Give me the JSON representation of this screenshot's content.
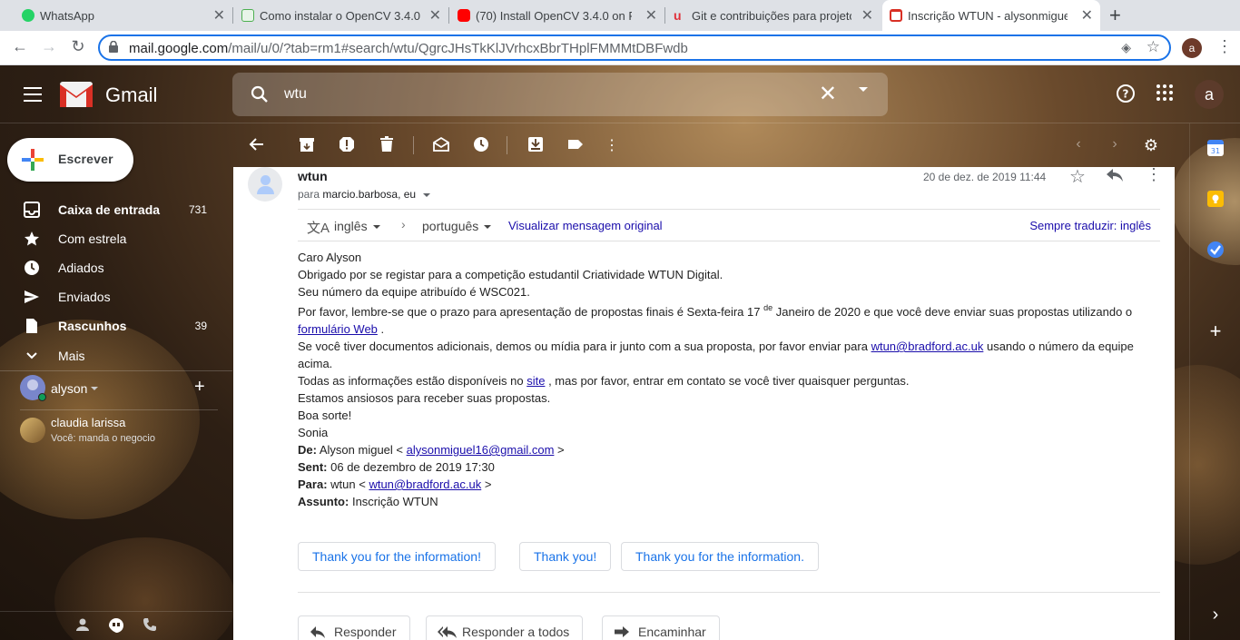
{
  "browser": {
    "tabs": [
      {
        "title": "WhatsApp",
        "icon": "whatsapp-icon",
        "color": "#25d366"
      },
      {
        "title": "Como instalar o OpenCV 3.4.0 c",
        "icon": "site-icon",
        "color": "#4caf50"
      },
      {
        "title": "(70) Install OpenCV 3.4.0 on Ras",
        "icon": "youtube-icon",
        "color": "#ff0000"
      },
      {
        "title": "Git e contribuições para projeto",
        "icon": "udemy-icon",
        "color": "#e0303a"
      },
      {
        "title": "Inscrição WTUN - alysonmiguel",
        "icon": "gmail-icon",
        "color": "#d93025"
      }
    ],
    "url_host": "mail.google.com",
    "url_path": "/mail/u/0/?tab=rm1#search/wtu/QgrcJHsTkKlJVrhcxBbrTHplFMMMtDBFwdb",
    "profile_initial": "a"
  },
  "gmail": {
    "brand": "Gmail",
    "search_value": "wtu",
    "account_initial": "a",
    "compose_label": "Escrever",
    "nav": [
      {
        "label": "Caixa de entrada",
        "count": "731",
        "icon": "inbox-icon",
        "bold": true
      },
      {
        "label": "Com estrela",
        "count": "",
        "icon": "star-icon",
        "bold": false
      },
      {
        "label": "Adiados",
        "count": "",
        "icon": "clock-icon",
        "bold": false
      },
      {
        "label": "Enviados",
        "count": "",
        "icon": "send-icon",
        "bold": false
      },
      {
        "label": "Rascunhos",
        "count": "39",
        "icon": "draft-icon",
        "bold": true
      },
      {
        "label": "Mais",
        "count": "",
        "icon": "chevron-down-icon",
        "bold": false
      }
    ],
    "hangouts": {
      "me": "alyson",
      "contact_name": "claudia larissa",
      "contact_status": "Você: manda o negocio"
    }
  },
  "message": {
    "sender": "wtun",
    "recipients_prefix": "para",
    "recipients": "marcio.barbosa, eu",
    "date": "20 de dez. de 2019 11:44",
    "translate": {
      "from": "inglês",
      "to": "português",
      "view_original": "Visualizar mensagem original",
      "always": "Sempre traduzir: inglês"
    },
    "body": {
      "greeting": "Caro Alyson",
      "line1": "Obrigado por se registar para a competição estudantil Criatividade WTUN Digital.",
      "line2": "Seu número da equipe atribuído é WSC021.",
      "line3_a": "Por favor, lembre-se que o prazo para apresentação de propostas finais é Sexta-feira 17",
      "line3_sup": "de",
      "line3_b": "Janeiro de 2020 e que você deve enviar suas propostas utilizando o",
      "line3_link": "formulário Web",
      "line3_end": ".",
      "line4_a": "Se você tiver documentos adicionais, demos ou mídia para ir junto com a sua proposta, por favor enviar para",
      "line4_link": "wtun@bradford.ac.uk",
      "line4_b": "usando o número da equipe",
      "line4_c": "acima.",
      "line5_a": "Todas as informações estão disponíveis no",
      "line5_link": "site",
      "line5_b": ", mas por favor, entrar em contato se você tiver quaisquer perguntas.",
      "line6": "Estamos ansiosos para receber suas propostas.",
      "line7": "Boa sorte!",
      "signature": "Sonia",
      "de_label": "De:",
      "de_name": "Alyson miguel <",
      "de_email": "alysonmiguel16@gmail.com",
      "de_end": ">",
      "sent_label": "Sent:",
      "sent_value": "06 de dezembro de 2019 17:30",
      "para_label": "Para:",
      "para_name": "wtun <",
      "para_email": "wtun@bradford.ac.uk",
      "para_end": ">",
      "assunto_label": "Assunto:",
      "assunto_value": "Inscrição WTUN"
    },
    "smart_replies": [
      "Thank you for the information!",
      "Thank you!",
      "Thank you for the information."
    ],
    "actions": {
      "reply": "Responder",
      "reply_all": "Responder a todos",
      "forward": "Encaminhar"
    }
  }
}
